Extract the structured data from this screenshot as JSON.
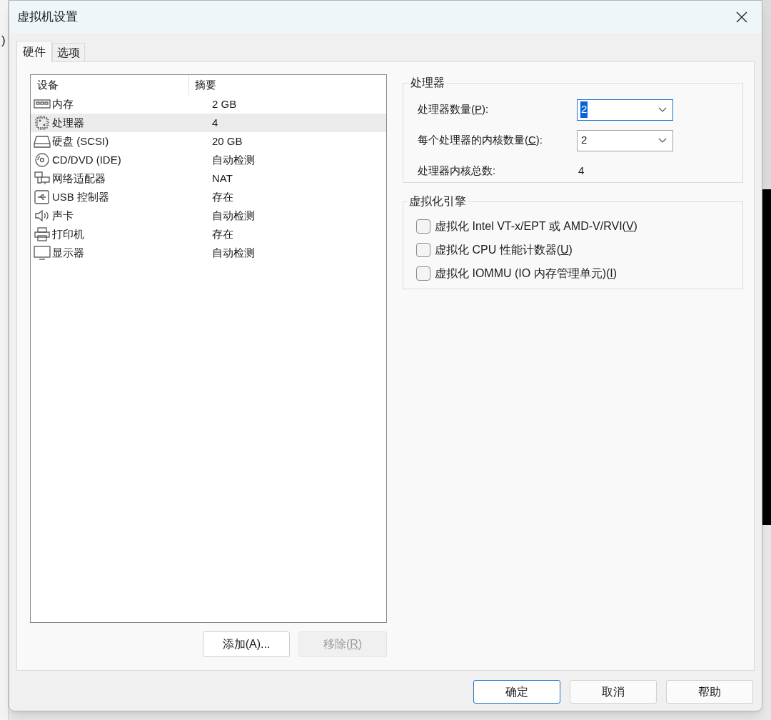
{
  "background": {
    "fragments": [
      ")"
    ]
  },
  "window": {
    "title": "虚拟机设置"
  },
  "tabs": [
    {
      "label": "硬件",
      "selected": true
    },
    {
      "label": "选项",
      "selected": false
    }
  ],
  "device_list": {
    "columns": [
      "设备",
      "摘要"
    ],
    "rows": [
      {
        "kind": "memory",
        "device": "内存",
        "summary": "2 GB",
        "selected": false
      },
      {
        "kind": "processor",
        "device": "处理器",
        "summary": "4",
        "selected": true
      },
      {
        "kind": "disk",
        "device": "硬盘 (SCSI)",
        "summary": "20 GB",
        "selected": false
      },
      {
        "kind": "cd",
        "device": "CD/DVD (IDE)",
        "summary": "自动检测",
        "selected": false
      },
      {
        "kind": "network",
        "device": "网络适配器",
        "summary": "NAT",
        "selected": false
      },
      {
        "kind": "usb",
        "device": "USB 控制器",
        "summary": "存在",
        "selected": false
      },
      {
        "kind": "sound",
        "device": "声卡",
        "summary": "自动检测",
        "selected": false
      },
      {
        "kind": "printer",
        "device": "打印机",
        "summary": "存在",
        "selected": false
      },
      {
        "kind": "display",
        "device": "显示器",
        "summary": "自动检测",
        "selected": false
      }
    ]
  },
  "list_buttons": [
    {
      "before": "添加(A)...",
      "disabled": false
    },
    {
      "before": "移除(",
      "key": "R",
      "after": ")",
      "disabled": true
    }
  ],
  "processor_group": {
    "title": "处理器",
    "fields": [
      {
        "kind": "dropdown",
        "label": {
          "before": "处理器数量(",
          "key": "P",
          "after": "):"
        },
        "value": "2",
        "focused": true
      },
      {
        "kind": "dropdown",
        "label": {
          "before": "每个处理器的内核数量(",
          "key": "C",
          "after": "):"
        },
        "value": "2",
        "focused": false
      },
      {
        "kind": "readout",
        "label": {
          "before": "处理器内核总数:"
        },
        "value": "4"
      }
    ]
  },
  "virtualization_group": {
    "title": "虚拟化引擎",
    "options": [
      {
        "label": {
          "before": "虚拟化 Intel VT-x/EPT 或 AMD-V/RVI(",
          "key": "V",
          "after": ")"
        },
        "checked": false
      },
      {
        "label": {
          "before": "虚拟化 CPU 性能计数器(",
          "key": "U",
          "after": ")"
        },
        "checked": false
      },
      {
        "label": {
          "before": "虚拟化 IOMMU (IO 内存管理单元)(",
          "key": "I",
          "after": ")"
        },
        "checked": false
      }
    ]
  },
  "dialog_buttons": [
    {
      "label": "确定",
      "default": true
    },
    {
      "label": "取消",
      "default": false
    },
    {
      "label": "帮助",
      "default": false
    }
  ]
}
